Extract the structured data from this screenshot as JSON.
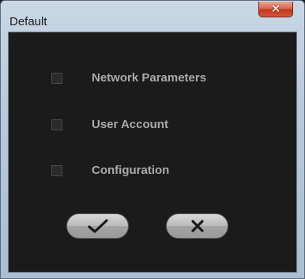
{
  "window": {
    "title": "Default",
    "close_glyph": "✕"
  },
  "options": [
    {
      "label": "Network Parameters",
      "checked": false
    },
    {
      "label": "User Account",
      "checked": false
    },
    {
      "label": "Configuration",
      "checked": false
    }
  ],
  "buttons": {
    "confirm_icon": "checkmark-icon",
    "cancel_icon": "x-icon"
  },
  "colors": {
    "client_background": "#1b1b1b",
    "label_text": "#aaaaaa",
    "close_button_red": "#c2371f"
  }
}
